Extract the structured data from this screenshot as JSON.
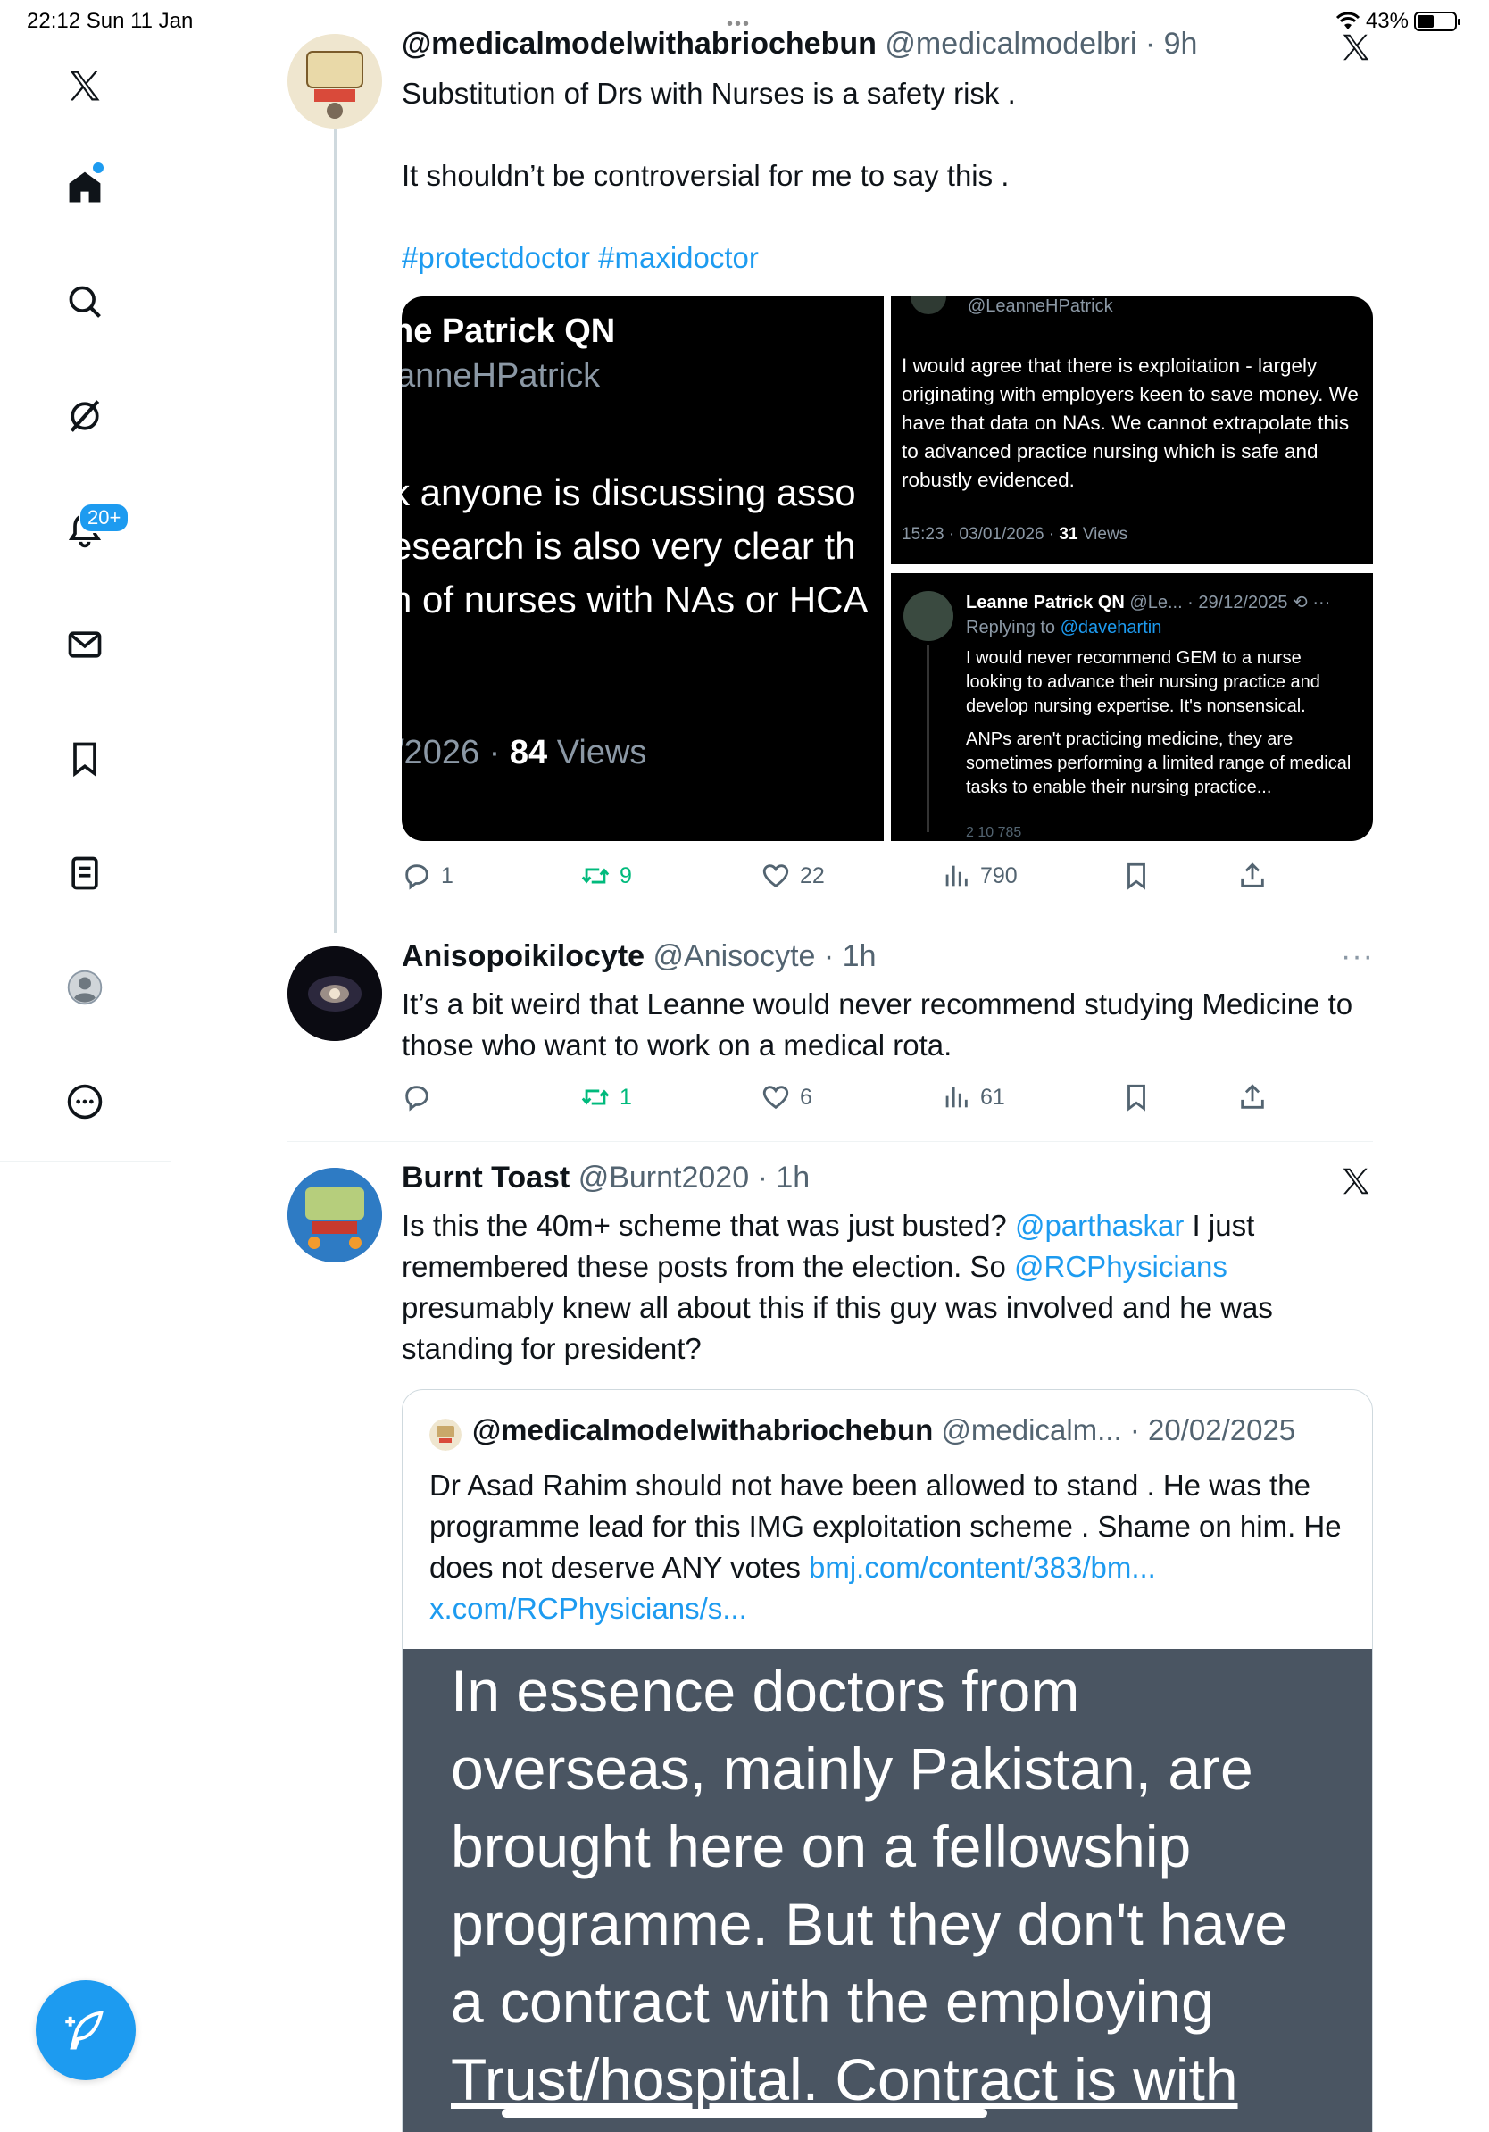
{
  "status_bar": {
    "time": "22:12  Sun 11 Jan",
    "battery": "43%",
    "multitask": "•••"
  },
  "sidebar": {
    "items": [
      {
        "name": "x-logo-icon"
      },
      {
        "name": "home-icon"
      },
      {
        "name": "search-icon"
      },
      {
        "name": "grok-icon"
      },
      {
        "name": "notifications-icon"
      },
      {
        "name": "messages-icon"
      },
      {
        "name": "bookmarks-icon"
      },
      {
        "name": "lists-icon"
      },
      {
        "name": "profile-icon"
      },
      {
        "name": "more-icon"
      }
    ],
    "notifications_badge": "20+"
  },
  "tweet1": {
    "name": "@medicalmodelwithabriochebun",
    "handle": "@medicalmodelbri",
    "time": "9h",
    "line1": "Substitution of Drs with Nurses is a safety risk .",
    "line2": "It shouldn’t be controversial for me to say this .",
    "hashtags": "#protectdoctor #maxidoctor",
    "media": {
      "left_title": "ne Patrick QN",
      "left_handle": "anneHPatrick",
      "left_lines": [
        "k anyone is discussing asso",
        "esearch is also very clear th",
        "n of nurses with NAs or HCA"
      ],
      "left_date": "/2026 · ",
      "left_views_num": "84",
      "left_views_label": " Views",
      "tr_handle": "@LeanneHPatrick",
      "tr_body": "I would agree that there is exploitation - largely originating with employers keen to save money. We have that data on NAs. We cannot extrapolate this to advanced practice nursing which is safe and robustly evidenced.",
      "tr_time": "15:23 · 03/01/2026 · ",
      "tr_views_num": "31",
      "tr_views_label": " Views",
      "br_name": "Leanne Patrick QN",
      "br_meta": " @Le... · 29/12/2025",
      "br_reply_prefix": "Replying to ",
      "br_reply_handle": "@davehartin",
      "br_body1": "I would never recommend GEM to a nurse looking to advance their nursing practice and develop nursing expertise. It's nonsensical.",
      "br_body2": "ANPs aren't practicing medicine, they are sometimes performing a limited range of medical tasks to enable their nursing practice...",
      "br_actions": "2          10         785"
    },
    "replies": "1",
    "reposts": "9",
    "likes": "22",
    "views": "790"
  },
  "tweet2": {
    "name": "Anisopoikilocyte",
    "handle": "@Anisocyte",
    "time": "1h",
    "text": "It’s a bit weird that Leanne would never recommend studying Medicine to those who want to work on a medical rota.",
    "replies": "",
    "reposts": "1",
    "likes": "6",
    "views": "61"
  },
  "tweet3": {
    "name": "Burnt Toast",
    "handle": "@Burnt2020",
    "time": "1h",
    "text_a": "Is this the 40m+ scheme that was just busted? ",
    "mention1": "@parthaskar",
    "text_b": " I just remembered these posts from the election. So ",
    "mention2": "@RCPhysicians",
    "text_c": " presumably knew all about this if this guy was involved and he was standing for president?",
    "quote": {
      "name": "@medicalmodelwithabriochebun",
      "handle": "@medicalm...",
      "date": "20/02/2025",
      "text_a": "Dr Asad Rahim should not have been allowed to stand . He was the programme lead for this IMG exploitation scheme . Shame on him. He does not deserve ANY votes ",
      "link1": "bmj.com/content/383/bm...",
      "link2": "x.com/RCPhysicians/s...",
      "image_lines": [
        "In essence doctors from",
        "overseas, mainly Pakistan, are",
        "brought here on a fellowship",
        "programme. But they don't have",
        "a contract with the employing",
        "Trust/hospital. Contract is with"
      ]
    }
  }
}
